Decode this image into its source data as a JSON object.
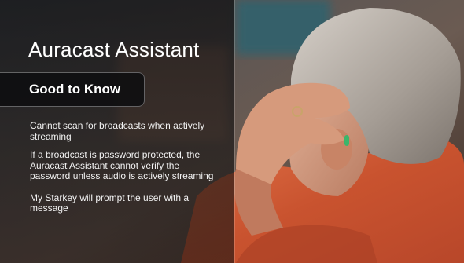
{
  "slide": {
    "title": "Auracast Assistant",
    "subtitle": "Good to Know",
    "bullets": [
      "Cannot scan for broadcasts when actively streaming",
      "If a broadcast is password protected, the Auracast Assistant cannot verify the password unless audio is actively streaming",
      "My Starkey will prompt the user with a message"
    ]
  },
  "colors": {
    "text": "#ffffff",
    "overlay": "#121214",
    "shirt": "#d8603a",
    "hair": "#b9b2aa"
  }
}
